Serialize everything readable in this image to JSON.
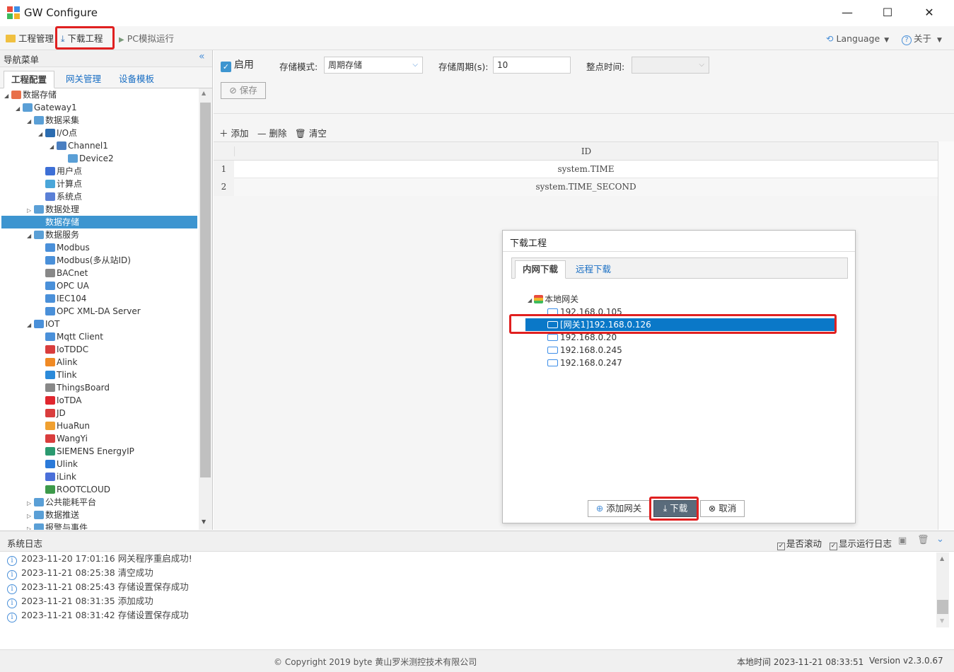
{
  "window": {
    "title": "GW Configure",
    "minimize": "—",
    "maximize": "☐",
    "close": "✕"
  },
  "menubar": {
    "project_mgmt": "工程管理",
    "download_project": "下载工程",
    "pc_simulate": "PC模拟运行",
    "language": "Language",
    "about": "关于"
  },
  "nav": {
    "title": "导航菜单",
    "tabs": [
      "工程配置",
      "网关管理",
      "设备模板"
    ],
    "tree": [
      {
        "label": "数据存储",
        "icon": "stack-icon"
      },
      {
        "label": "Gateway1",
        "icon": "gateway-icon"
      },
      {
        "label": "数据采集",
        "icon": "monitor-icon"
      },
      {
        "label": "I/O点",
        "icon": "io-icon"
      },
      {
        "label": "Channel1",
        "icon": "channel-icon"
      },
      {
        "label": "Device2",
        "icon": "device-icon"
      },
      {
        "label": "用户点",
        "icon": "user-point-icon"
      },
      {
        "label": "计算点",
        "icon": "calc-point-icon"
      },
      {
        "label": "系统点",
        "icon": "system-point-icon"
      },
      {
        "label": "数据处理",
        "icon": "chart-icon"
      },
      {
        "label": "数据存储",
        "icon": "database-icon"
      },
      {
        "label": "数据服务",
        "icon": "service-icon"
      },
      {
        "label": "Modbus",
        "icon": "modbus-icon"
      },
      {
        "label": "Modbus(多从站ID)",
        "icon": "modbus-icon"
      },
      {
        "label": "BACnet",
        "icon": "bacnet-icon"
      },
      {
        "label": "OPC UA",
        "icon": "opcua-icon"
      },
      {
        "label": "IEC104",
        "icon": "iec-icon"
      },
      {
        "label": "OPC XML-DA Server",
        "icon": "opcxml-icon"
      },
      {
        "label": "IOT",
        "icon": "iot-icon"
      },
      {
        "label": "Mqtt Client",
        "icon": "mqtt-icon"
      },
      {
        "label": "IoTDDC",
        "icon": "iotddc-icon"
      },
      {
        "label": "Alink",
        "icon": "alink-icon"
      },
      {
        "label": "Tlink",
        "icon": "tlink-icon"
      },
      {
        "label": "ThingsBoard",
        "icon": "thingsboard-icon"
      },
      {
        "label": "IoTDA",
        "icon": "huawei-icon"
      },
      {
        "label": "JD",
        "icon": "jd-icon"
      },
      {
        "label": "HuaRun",
        "icon": "huarun-icon"
      },
      {
        "label": "WangYi",
        "icon": "wangyi-icon"
      },
      {
        "label": "SIEMENS EnergyIP",
        "icon": "siemens-icon"
      },
      {
        "label": "Ulink",
        "icon": "ulink-icon"
      },
      {
        "label": "iLink",
        "icon": "ilink-icon"
      },
      {
        "label": "ROOTCLOUD",
        "icon": "rootcloud-icon"
      },
      {
        "label": "公共能耗平台",
        "icon": "energy-icon"
      },
      {
        "label": "数据推送",
        "icon": "push-icon"
      },
      {
        "label": "报警与事件",
        "icon": "alarm-icon"
      }
    ]
  },
  "storage": {
    "enable_label": "启用",
    "mode_label": "存储模式:",
    "mode_value": "周期存储",
    "period_label": "存储周期(s):",
    "period_value": "10",
    "time_label": "整点时间:",
    "save_label": "保存"
  },
  "grid_toolbar": {
    "add": "添加",
    "delete": "删除",
    "clear": "清空"
  },
  "grid": {
    "header": "ID",
    "rows": [
      {
        "num": "1",
        "id": "system.TIME"
      },
      {
        "num": "2",
        "id": "system.TIME_SECOND"
      }
    ]
  },
  "dialog": {
    "title": "下载工程",
    "tabs": [
      "内网下载",
      "远程下载"
    ],
    "root": "本地网关",
    "gateways": [
      "192.168.0.105",
      "[网关1]192.168.0.126",
      "192.168.0.20",
      "192.168.0.245",
      "192.168.0.247"
    ],
    "add_gateway": "添加网关",
    "download": "下载",
    "cancel": "取消"
  },
  "log": {
    "title": "系统日志",
    "scroll_label": "是否滚动",
    "show_label": "显示运行日志",
    "lines": [
      "2023-11-20 17:01:16 网关程序重启成功!",
      "2023-11-21 08:25:38 清空成功",
      "2023-11-21 08:25:43 存储设置保存成功",
      "2023-11-21 08:31:35 添加成功",
      "2023-11-21 08:31:42 存储设置保存成功"
    ]
  },
  "footer": {
    "copyright": "© Copyright 2019 byte 黄山罗米测控技术有限公司",
    "local_time": "本地时间 2023-11-21 08:33:51",
    "version": "Version v2.3.0.67"
  },
  "colors": {
    "accent": "#1a6fc4",
    "selection": "#3d95d0",
    "dialog_selection": "#0a78c8",
    "highlight": "#e02020"
  }
}
